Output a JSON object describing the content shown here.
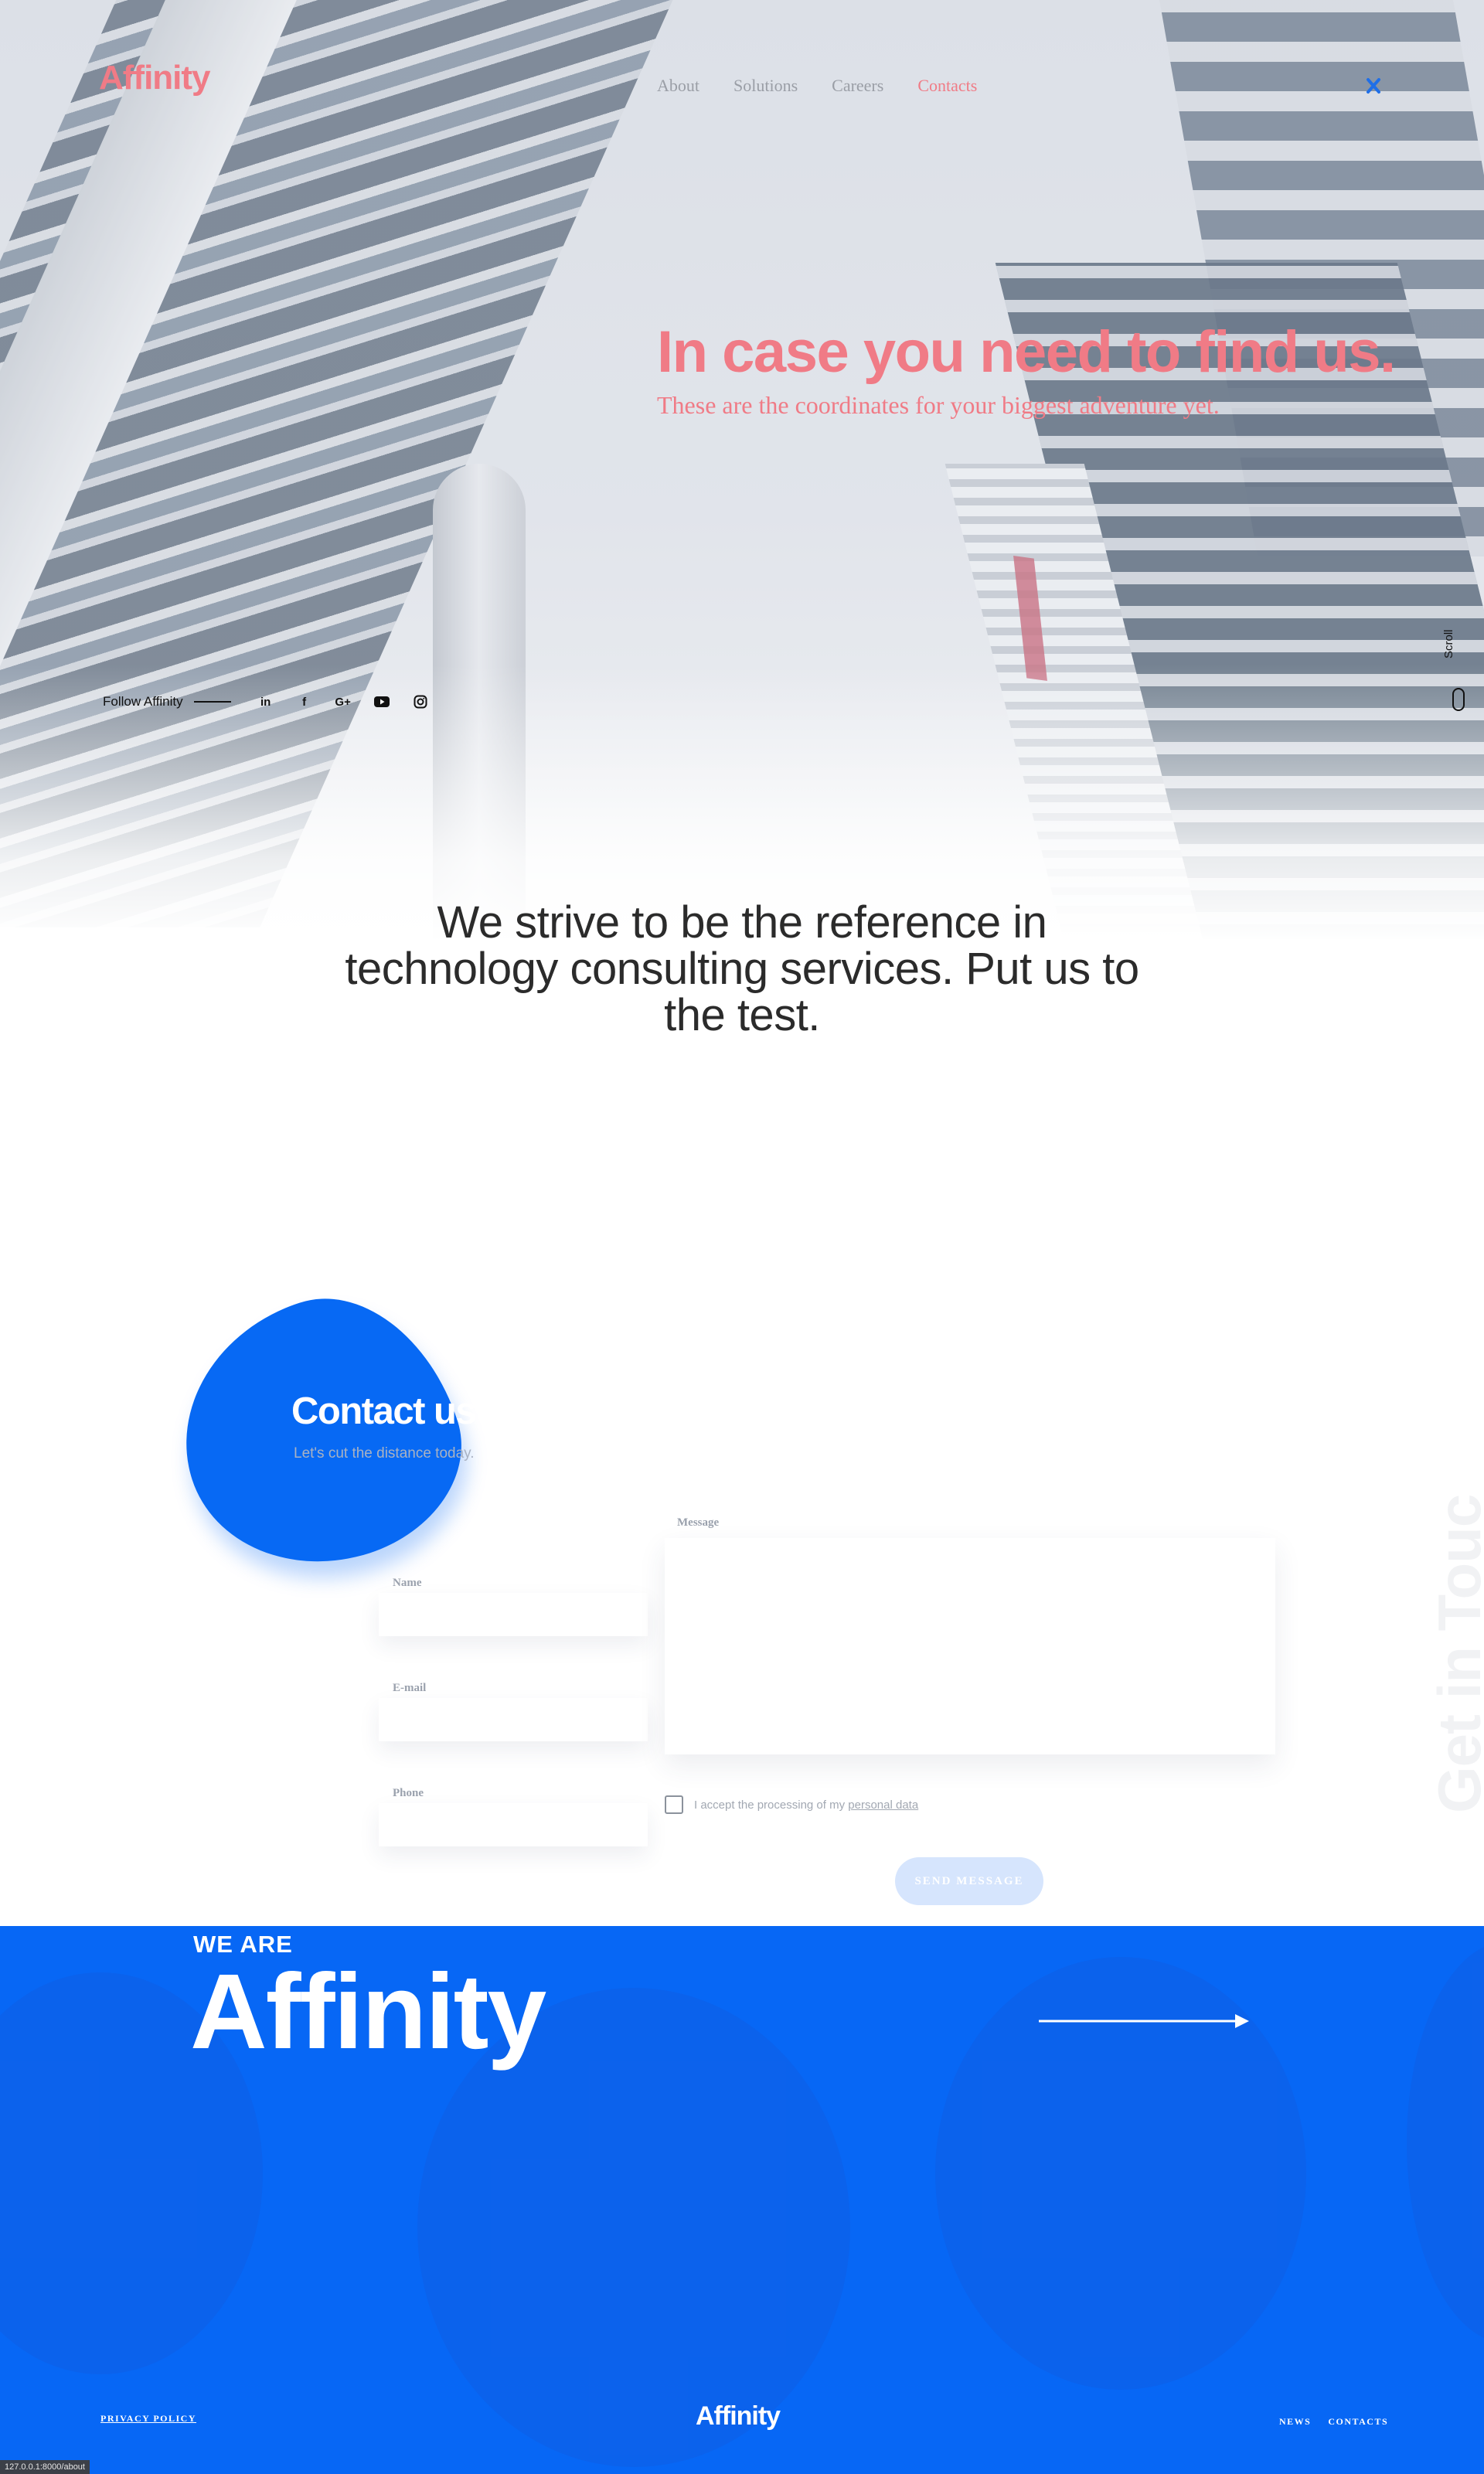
{
  "header": {
    "logo": "Affinity",
    "nav": [
      {
        "label": "About"
      },
      {
        "label": "Solutions"
      },
      {
        "label": "Careers"
      },
      {
        "label": "Contacts"
      }
    ],
    "active_nav": "Contacts",
    "menu_icon": "close-x-icon"
  },
  "hero": {
    "title": "In case you need to find us.",
    "subtitle": "These are the coordinates for your biggest adventure yet.",
    "follow_label": "Follow Affinity",
    "social_icons": [
      "linkedin-icon",
      "facebook-icon",
      "google-plus-icon",
      "youtube-icon",
      "instagram-icon"
    ],
    "scroll_label": "Scroll"
  },
  "tagline": "We strive to be the reference in technology consulting services. Put us to the test.",
  "contact": {
    "title": "Contact us",
    "subtitle": "Let's cut the distance today.",
    "fields": {
      "name_label": "Name",
      "email_label": "E-mail",
      "phone_label": "Phone",
      "message_label": "Message"
    },
    "consent_text": "I accept the processing of my",
    "consent_link": "personal data",
    "send_label": "SEND MESSAGE",
    "side_text": "Get in Touch"
  },
  "footer": {
    "we_are": "WE ARE",
    "brand_big": "Affinity",
    "privacy": "PRIVACY POLICY",
    "logo": "Affinity",
    "links": [
      {
        "label": "NEWS"
      },
      {
        "label": "CONTACTS"
      }
    ],
    "status_url": "127.0.0.1:8000/about"
  },
  "colors": {
    "accent_pink": "#f07b86",
    "brand_blue": "#0767f5",
    "text_dark": "#2b2b2b",
    "muted_label": "#9aa1ad"
  }
}
